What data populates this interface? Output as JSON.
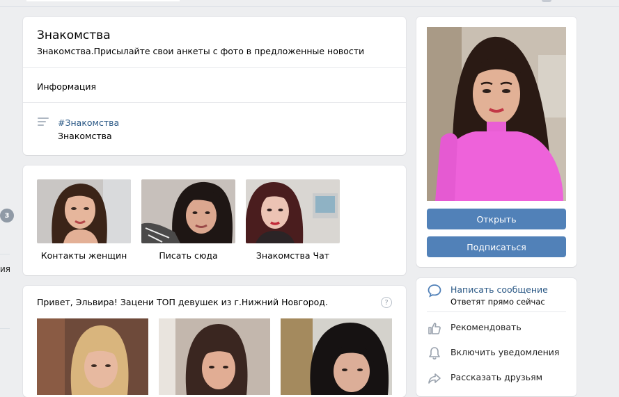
{
  "group": {
    "name": "Знакомства",
    "status": "Знакомства.Присылайте свои анкеты с фото в предложенные новости",
    "info_tab": "Информация",
    "tag": "#Знакомства",
    "description": "Знакомства"
  },
  "left_edge": {
    "badge_count": "3",
    "cut_text": "ия"
  },
  "albums": [
    {
      "label": "Контакты женщин"
    },
    {
      "label": "Писать сюда"
    },
    {
      "label": "Знакомства Чат"
    }
  ],
  "post": {
    "text": "Привет, Эльвира! Зацени ТОП девушек из г.Нижний Новгород.",
    "help_symbol": "?"
  },
  "avatar": {
    "open_button": "Открыть",
    "subscribe_button": "Подписаться"
  },
  "actions": {
    "message_label": "Написать сообщение",
    "message_sub": "Ответят прямо сейчас",
    "recommend_label": "Рекомендовать",
    "notify_label": "Включить уведомления",
    "share_label": "Рассказать друзьям"
  },
  "colors": {
    "accent": "#5181b8",
    "link": "#2a5885",
    "background": "#edeef0"
  },
  "icons": [
    "description-icon",
    "help-icon",
    "message-bubble-icon",
    "thumbs-up-icon",
    "bell-icon",
    "share-arrow-icon"
  ]
}
